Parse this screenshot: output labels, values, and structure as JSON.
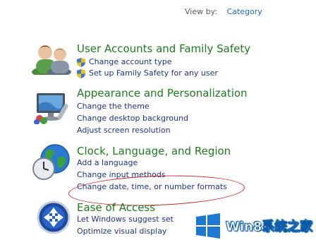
{
  "header": {
    "view_by_label": "View by:",
    "view_by_value": "Category"
  },
  "categories": [
    {
      "title": "User Accounts and Family Safety",
      "links": [
        "Change account type",
        "Set up Family Safety for any user"
      ]
    },
    {
      "title": "Appearance and Personalization",
      "links": [
        "Change the theme",
        "Change desktop background",
        "Adjust screen resolution"
      ]
    },
    {
      "title": "Clock, Language, and Region",
      "links": [
        "Add a language",
        "Change input methods",
        "Change date, time, or number formats"
      ]
    },
    {
      "title": "Ease of Access",
      "links": [
        "Let Windows suggest set",
        "Optimize visual display"
      ]
    }
  ],
  "watermark": {
    "text": "Win8系统之家"
  },
  "colors": {
    "category_title": "#1f7a1f",
    "link": "#1e3287",
    "highlight_ellipse": "#c32828"
  },
  "icons": [
    "users-icon",
    "shield-icon",
    "display-icon",
    "globe-clock-icon",
    "ease-of-access-icon",
    "windows-logo-icon"
  ]
}
